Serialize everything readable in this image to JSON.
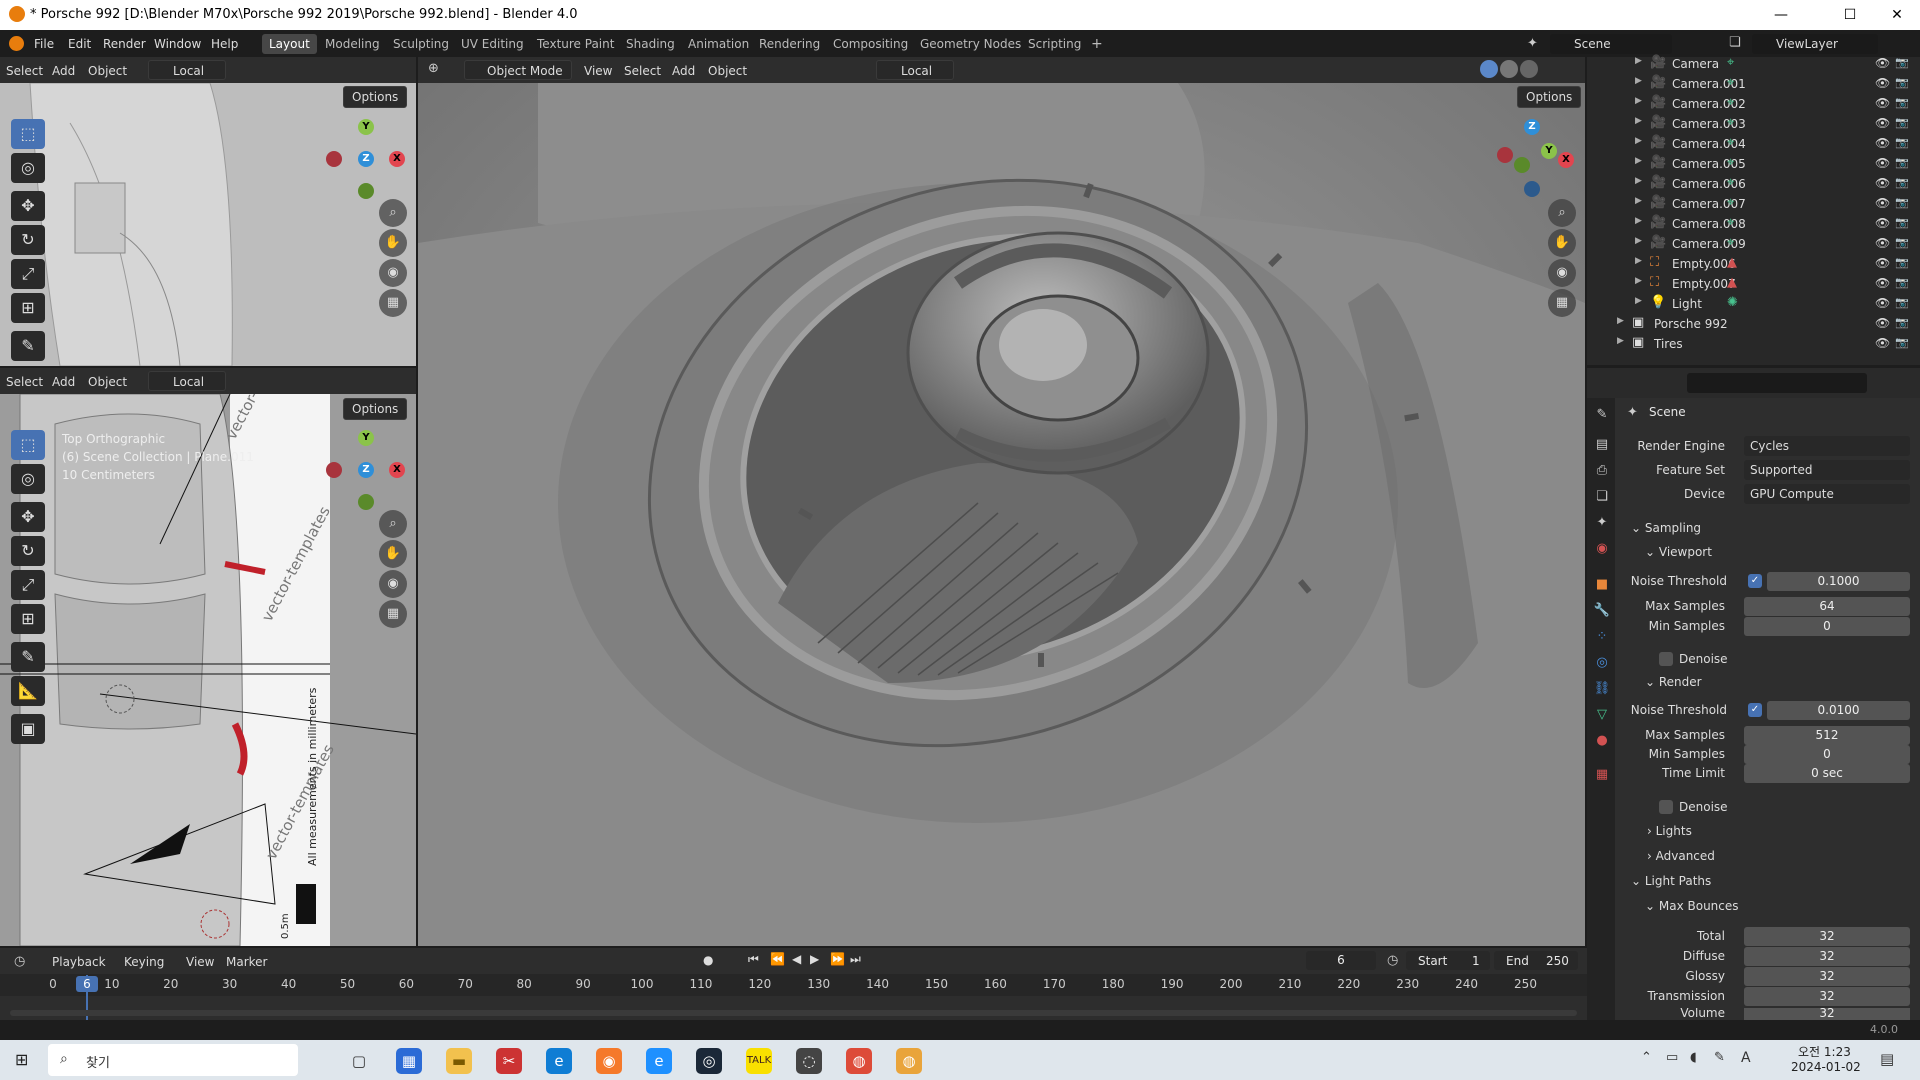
{
  "window": {
    "title": "* Porsche 992 [D:\\Blender M70x\\Porsche 992 2019\\Porsche 992.blend] - Blender 4.0",
    "minimize": "—",
    "maximize": "☐",
    "close": "✕"
  },
  "menu": {
    "items": [
      "File",
      "Edit",
      "Render",
      "Window",
      "Help"
    ],
    "workspaces": [
      "Layout",
      "Modeling",
      "Sculpting",
      "UV Editing",
      "Texture Paint",
      "Shading",
      "Animation",
      "Rendering",
      "Compositing",
      "Geometry Nodes",
      "Scripting"
    ],
    "add_tab": "+",
    "scene": "Scene",
    "view_layer": "ViewLayer"
  },
  "viewport_small": {
    "menu": [
      "Select",
      "Add",
      "Object"
    ],
    "transform": "Local",
    "options": "Options"
  },
  "viewport_top": {
    "menu": [
      "Select",
      "Add",
      "Object"
    ],
    "transform": "Local",
    "options": "Options",
    "overlay_lines": [
      "Top Orthographic",
      "(6) Scene Collection | Plane.011",
      "10 Centimeters"
    ],
    "bg_text": [
      "vector-templates",
      "All measurements in millimeters",
      "0.5m"
    ]
  },
  "viewport_main": {
    "mode": "Object Mode",
    "menu": [
      "View",
      "Select",
      "Add",
      "Object"
    ],
    "transform": "Local",
    "options": "Options"
  },
  "gizmo": {
    "x": "X",
    "y": "Y",
    "z": "Z"
  },
  "outliner": {
    "items": [
      {
        "name": "Camera",
        "type": "camera"
      },
      {
        "name": "Camera.001",
        "type": "camera"
      },
      {
        "name": "Camera.002",
        "type": "camera"
      },
      {
        "name": "Camera.003",
        "type": "camera"
      },
      {
        "name": "Camera.004",
        "type": "camera"
      },
      {
        "name": "Camera.005",
        "type": "camera"
      },
      {
        "name": "Camera.006",
        "type": "camera"
      },
      {
        "name": "Camera.007",
        "type": "camera"
      },
      {
        "name": "Camera.008",
        "type": "camera"
      },
      {
        "name": "Camera.009",
        "type": "camera"
      },
      {
        "name": "Empty.006",
        "type": "empty"
      },
      {
        "name": "Empty.007",
        "type": "empty"
      },
      {
        "name": "Light",
        "type": "light"
      },
      {
        "name": "Porsche 992",
        "type": "collection"
      },
      {
        "name": "Tires",
        "type": "collection"
      }
    ]
  },
  "properties": {
    "context": "Scene",
    "render_engine": {
      "label": "Render Engine",
      "value": "Cycles"
    },
    "feature_set": {
      "label": "Feature Set",
      "value": "Supported"
    },
    "device": {
      "label": "Device",
      "value": "GPU Compute"
    },
    "sampling": "Sampling",
    "viewport": {
      "title": "Viewport",
      "noise_threshold_label": "Noise Threshold",
      "noise_threshold": "0.1000",
      "max_samples_label": "Max Samples",
      "max_samples": "64",
      "min_samples_label": "Min Samples",
      "min_samples": "0",
      "denoise": "Denoise"
    },
    "render": {
      "title": "Render",
      "noise_threshold_label": "Noise Threshold",
      "noise_threshold": "0.0100",
      "max_samples_label": "Max Samples",
      "max_samples": "512",
      "min_samples_label": "Min Samples",
      "min_samples": "0",
      "time_limit_label": "Time Limit",
      "time_limit": "0 sec",
      "denoise": "Denoise"
    },
    "lights": "Lights",
    "advanced": "Advanced",
    "light_paths": "Light Paths",
    "max_bounces": "Max Bounces",
    "bounces": [
      {
        "label": "Total",
        "value": "32"
      },
      {
        "label": "Diffuse",
        "value": "32"
      },
      {
        "label": "Glossy",
        "value": "32"
      },
      {
        "label": "Transmission",
        "value": "32"
      },
      {
        "label": "Volume",
        "value": "32"
      }
    ]
  },
  "timeline": {
    "menu": [
      "Playback",
      "Keying",
      "View",
      "Marker"
    ],
    "current_frame": "6",
    "start_label": "Start",
    "start": "1",
    "end_label": "End",
    "end": "250",
    "ticks": [
      "0",
      "10",
      "20",
      "30",
      "40",
      "50",
      "60",
      "70",
      "80",
      "90",
      "100",
      "110",
      "120",
      "130",
      "140",
      "150",
      "160",
      "170",
      "180",
      "190",
      "200",
      "210",
      "220",
      "230",
      "240",
      "250"
    ]
  },
  "status": {
    "version": "4.0.0"
  },
  "taskbar": {
    "search": "찾기",
    "time": "오전 1:23",
    "date": "2024-01-02",
    "ime": "A"
  }
}
